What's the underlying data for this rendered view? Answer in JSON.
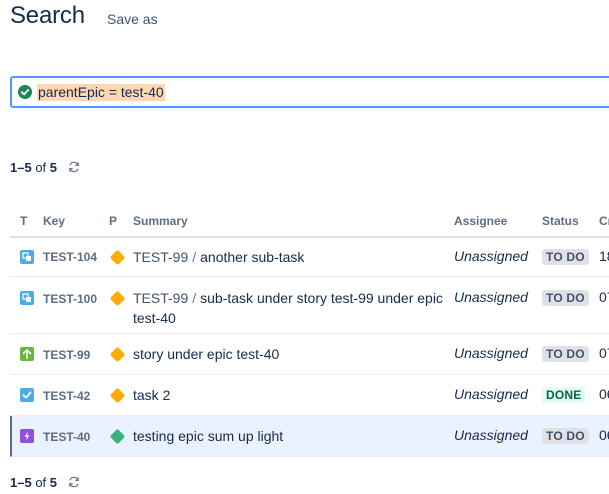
{
  "header": {
    "title": "Search",
    "save_as": "Save as"
  },
  "query": {
    "text": "parentEpic = test-40",
    "valid": true
  },
  "pager": {
    "range": "1–5",
    "of": "of",
    "total": "5"
  },
  "table": {
    "columns": [
      "T",
      "Key",
      "P",
      "Summary",
      "Assignee",
      "Status",
      "Cr"
    ],
    "rows": [
      {
        "type": "subtask",
        "key": "TEST-104",
        "priority": "medium",
        "parent": "TEST-99",
        "summary": "another sub-task",
        "assignee": "Unassigned",
        "status": "TO DO",
        "created": "18"
      },
      {
        "type": "subtask",
        "key": "TEST-100",
        "priority": "medium",
        "parent": "TEST-99",
        "summary": "sub-task under story test-99 under epic test-40",
        "assignee": "Unassigned",
        "status": "TO DO",
        "created": "07"
      },
      {
        "type": "story",
        "key": "TEST-99",
        "priority": "medium",
        "parent": "",
        "summary": "story under epic test-40",
        "assignee": "Unassigned",
        "status": "TO DO",
        "created": "07"
      },
      {
        "type": "task",
        "key": "TEST-42",
        "priority": "medium",
        "parent": "",
        "summary": "task 2",
        "assignee": "Unassigned",
        "status": "DONE",
        "created": "06"
      },
      {
        "type": "epic",
        "key": "TEST-40",
        "priority": "low",
        "parent": "",
        "summary": "testing epic sum up light",
        "assignee": "Unassigned",
        "status": "TO DO",
        "created": "06"
      }
    ]
  },
  "colors": {
    "subtask": "#4bade8",
    "story": "#63ba3c",
    "task": "#4bade8",
    "epic": "#904ee2",
    "priority_medium": "#ffab00",
    "priority_low": "#36b37e",
    "query_highlight": "#ffd7b5",
    "focus_border": "#4c9aff"
  },
  "icons": {
    "subtask": "subtask-icon",
    "story": "story-icon",
    "task": "task-icon",
    "epic": "epic-icon",
    "medium": "priority-medium-icon",
    "low": "priority-low-icon",
    "refresh": "refresh-icon",
    "check": "check-icon"
  }
}
